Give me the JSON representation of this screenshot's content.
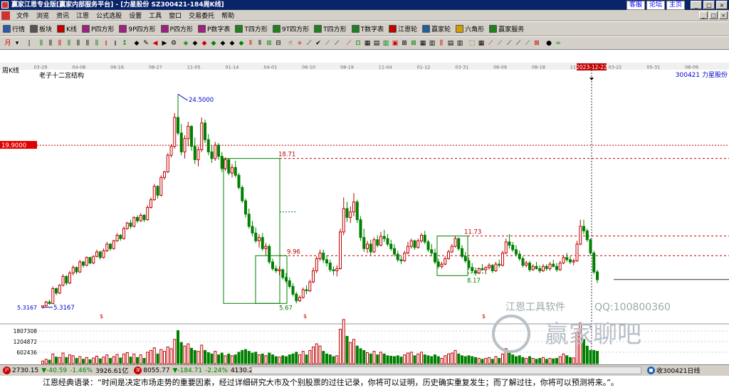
{
  "window": {
    "title": "赢家江恩专业版[赢家内部服务平台] - [力星股份  SZ300421-184周K线]",
    "links": [
      "客服",
      "论坛",
      "主页"
    ],
    "buttons": [
      "_",
      "□",
      "×"
    ]
  },
  "menu": [
    "文件",
    "浏览",
    "资讯",
    "江恩",
    "公式选股",
    "设置",
    "工具",
    "窗口",
    "交易委托",
    "帮助"
  ],
  "toolbar1": [
    {
      "label": "行情",
      "icon": "table-icon",
      "color": "#2a5aa8"
    },
    {
      "label": "板块",
      "icon": "sector-icon",
      "color": "#555555"
    },
    {
      "label": "K线",
      "icon": "candle-icon",
      "color": "#c00000"
    },
    {
      "label": "P四方形",
      "icon": "p-square-icon",
      "color": "#a02080"
    },
    {
      "label": "9P四方形",
      "icon": "9p-square-icon",
      "color": "#a02080"
    },
    {
      "label": "P四方形",
      "icon": "p-square-icon",
      "color": "#a02080"
    },
    {
      "label": "P数字表",
      "icon": "p-table-icon",
      "color": "#a02080"
    },
    {
      "label": "T四方形",
      "icon": "t-square-icon",
      "color": "#208020"
    },
    {
      "label": "9T四方形",
      "icon": "9t-square-icon",
      "color": "#208020"
    },
    {
      "label": "T四方形",
      "icon": "t-square-icon",
      "color": "#208020"
    },
    {
      "label": "T数字表",
      "icon": "t-table-icon",
      "color": "#208020"
    },
    {
      "label": "江恩轮",
      "icon": "wheel-icon",
      "color": "#c00000"
    },
    {
      "label": "赢家轮",
      "icon": "wheel-icon",
      "color": "#2060a0"
    },
    {
      "label": "六角形",
      "icon": "hexagon-icon",
      "color": "#d0a000"
    },
    {
      "label": "赢家服务",
      "icon": "service-icon",
      "color": "#208020"
    }
  ],
  "chart_label": "周K线",
  "stock_label": "300421  力星股份",
  "structure_label": "老子十二宫结构",
  "crosshair_date": "2023-12-22",
  "left_price_tag": "19.9000",
  "date_axis": [
    "03-29",
    "04-08",
    "06-16",
    "08-27",
    "11-05",
    "01-14",
    "04-01",
    "06-10",
    "08-19",
    "11-04",
    "01-12",
    "03-31",
    "06-09",
    "08-18",
    "11-03",
    "03-22",
    "05-31",
    "08-09"
  ],
  "annotations": {
    "high": "24.5000",
    "low_left": "5.3167",
    "low_left_axis": "5.3167",
    "level_1871": "18.71",
    "level_996": "9.96",
    "level_1173": "11.73",
    "level_817": "8.17",
    "low_mid": "5.67",
    "dollar_1": "$",
    "dollar_2": "$",
    "dollar_3": "$"
  },
  "volume_axis": [
    "1807308",
    "1204872",
    "602436"
  ],
  "watermark": {
    "software": "江恩工具软件",
    "qq": "QQ:100800360",
    "brand": "赢家聊吧"
  },
  "status": {
    "sh_value": "2730.15",
    "sh_change": "▼-40.59",
    "sh_pct": "-1.46%",
    "sh_amount": "3926.61亿",
    "sz_value": "8055.77",
    "sz_change": "▼-184.71",
    "sz_pct": "-2.24%",
    "sz_amount": "4130.2",
    "right_label": "收300421日线"
  },
  "quote": "江恩经典语录：“时间是决定市场走势的重要因素，经过详细研究大市及个别股票的过往记录，你将可以证明，历史确实重复发生；而了解过往，你将可以预测将来。”。",
  "colors": {
    "up": "#c00000",
    "down": "#008000",
    "level_line": "#c00000",
    "box": "#008000",
    "title_bar": "#0a246a",
    "crosshair_tag": "#c00000"
  },
  "chart_data": {
    "type": "candlestick",
    "ylim": [
      4.6,
      26.5
    ],
    "candles": [
      [
        5.32,
        5.5,
        5.2,
        5.45
      ],
      [
        5.45,
        5.9,
        5.4,
        5.8
      ],
      [
        5.8,
        6.0,
        5.55,
        5.65
      ],
      [
        5.65,
        7.2,
        5.6,
        7.0
      ],
      [
        7.0,
        7.1,
        6.4,
        6.6
      ],
      [
        6.6,
        7.4,
        6.5,
        7.3
      ],
      [
        7.3,
        8.3,
        7.2,
        8.1
      ],
      [
        8.1,
        8.2,
        7.3,
        7.5
      ],
      [
        7.5,
        8.6,
        7.4,
        8.4
      ],
      [
        8.4,
        9.1,
        8.2,
        8.9
      ],
      [
        8.9,
        9.0,
        8.3,
        8.5
      ],
      [
        8.5,
        9.6,
        8.4,
        9.4
      ],
      [
        9.4,
        9.5,
        8.9,
        9.1
      ],
      [
        9.1,
        9.9,
        9.0,
        9.8
      ],
      [
        9.8,
        9.85,
        9.2,
        9.3
      ],
      [
        9.3,
        10.0,
        9.2,
        9.9
      ],
      [
        9.9,
        10.5,
        9.8,
        10.3
      ],
      [
        10.3,
        10.4,
        9.6,
        9.8
      ],
      [
        9.8,
        10.6,
        9.7,
        10.4
      ],
      [
        10.4,
        11.2,
        10.3,
        11.0
      ],
      [
        11.0,
        11.1,
        10.4,
        10.6
      ],
      [
        10.6,
        11.4,
        10.5,
        11.3
      ],
      [
        11.3,
        12.0,
        11.2,
        11.8
      ],
      [
        11.8,
        11.9,
        11.3,
        11.5
      ],
      [
        11.5,
        12.6,
        11.4,
        12.4
      ],
      [
        12.4,
        13.0,
        12.3,
        12.9
      ],
      [
        12.9,
        13.2,
        12.4,
        12.6
      ],
      [
        12.6,
        13.5,
        12.5,
        13.4
      ],
      [
        13.4,
        13.6,
        12.9,
        13.1
      ],
      [
        13.1,
        13.8,
        13.0,
        13.6
      ],
      [
        13.6,
        13.7,
        13.0,
        13.2
      ],
      [
        13.2,
        14.5,
        13.1,
        14.3
      ],
      [
        14.3,
        15.2,
        14.2,
        15.0
      ],
      [
        15.0,
        16.4,
        14.9,
        16.2
      ],
      [
        16.2,
        16.3,
        15.1,
        15.4
      ],
      [
        15.4,
        17.2,
        15.3,
        17.0
      ],
      [
        17.0,
        17.6,
        16.8,
        17.5
      ],
      [
        17.5,
        19.2,
        17.4,
        19.0
      ],
      [
        19.0,
        20.0,
        18.8,
        19.8
      ],
      [
        19.8,
        22.8,
        19.6,
        22.4
      ],
      [
        22.4,
        24.5,
        20.8,
        21.0
      ],
      [
        21.0,
        21.8,
        19.0,
        19.3
      ],
      [
        19.3,
        20.8,
        18.7,
        20.5
      ],
      [
        20.5,
        22.0,
        19.8,
        21.6
      ],
      [
        21.6,
        21.7,
        19.4,
        19.8
      ],
      [
        19.8,
        20.6,
        18.2,
        18.6
      ],
      [
        18.6,
        19.8,
        18.0,
        19.5
      ],
      [
        19.5,
        22.4,
        19.3,
        21.9
      ],
      [
        21.9,
        22.2,
        20.1,
        20.4
      ],
      [
        20.4,
        20.9,
        19.0,
        19.3
      ],
      [
        19.3,
        19.9,
        18.3,
        18.7
      ],
      [
        18.7,
        20.2,
        18.5,
        19.9
      ],
      [
        19.9,
        20.1,
        18.6,
        18.9
      ],
      [
        18.9,
        19.3,
        17.5,
        17.8
      ],
      [
        17.8,
        18.8,
        17.6,
        18.6
      ],
      [
        18.6,
        18.7,
        17.2,
        17.4
      ],
      [
        17.4,
        18.2,
        17.0,
        17.9
      ],
      [
        17.9,
        18.5,
        17.0,
        17.2
      ],
      [
        17.2,
        17.4,
        15.9,
        16.1
      ],
      [
        16.1,
        16.3,
        14.7,
        14.9
      ],
      [
        14.9,
        15.1,
        13.4,
        13.7
      ],
      [
        13.7,
        14.2,
        12.4,
        12.6
      ],
      [
        12.6,
        13.1,
        11.7,
        12.0
      ],
      [
        12.0,
        12.5,
        11.1,
        11.3
      ],
      [
        11.3,
        11.9,
        10.7,
        11.6
      ],
      [
        11.6,
        12.0,
        10.4,
        10.6
      ],
      [
        10.6,
        11.1,
        10.0,
        10.8
      ],
      [
        10.8,
        11.0,
        9.2,
        9.4
      ],
      [
        9.4,
        9.7,
        8.6,
        8.8
      ],
      [
        8.8,
        9.1,
        8.4,
        8.6
      ],
      [
        8.6,
        9.0,
        8.2,
        8.7
      ],
      [
        8.7,
        8.8,
        7.8,
        8.0
      ],
      [
        8.0,
        8.4,
        7.5,
        7.7
      ],
      [
        7.7,
        8.0,
        7.0,
        7.2
      ],
      [
        7.2,
        7.5,
        6.3,
        6.5
      ],
      [
        6.5,
        6.7,
        5.67,
        5.9
      ],
      [
        5.9,
        6.4,
        5.8,
        6.2
      ],
      [
        6.2,
        7.1,
        6.1,
        6.9
      ],
      [
        6.9,
        7.3,
        6.5,
        6.8
      ],
      [
        6.8,
        7.8,
        6.7,
        7.6
      ],
      [
        7.6,
        8.9,
        7.5,
        8.6
      ],
      [
        8.6,
        9.9,
        8.4,
        9.7
      ],
      [
        9.7,
        10.5,
        9.5,
        10.2
      ],
      [
        10.2,
        10.5,
        9.3,
        9.6
      ],
      [
        9.6,
        10.0,
        9.0,
        9.3
      ],
      [
        9.3,
        9.6,
        8.5,
        8.7
      ],
      [
        8.7,
        9.0,
        8.2,
        8.6
      ],
      [
        8.6,
        9.1,
        8.1,
        8.8
      ],
      [
        8.8,
        12.4,
        8.7,
        12.1
      ],
      [
        12.1,
        15.2,
        11.8,
        14.2
      ],
      [
        14.2,
        14.8,
        13.0,
        13.4
      ],
      [
        13.4,
        14.4,
        12.9,
        13.9
      ],
      [
        13.9,
        15.6,
        13.5,
        14.8
      ],
      [
        14.8,
        15.0,
        12.9,
        13.2
      ],
      [
        13.2,
        13.5,
        11.3,
        11.6
      ],
      [
        11.6,
        12.4,
        10.3,
        10.6
      ],
      [
        10.6,
        11.3,
        10.2,
        11.0
      ],
      [
        11.0,
        11.4,
        10.0,
        10.3
      ],
      [
        10.3,
        11.6,
        10.2,
        11.4
      ],
      [
        11.4,
        11.8,
        10.7,
        10.9
      ],
      [
        10.9,
        12.1,
        10.8,
        11.7
      ],
      [
        11.7,
        12.3,
        11.2,
        11.5
      ],
      [
        11.5,
        11.9,
        10.8,
        11.0
      ],
      [
        11.0,
        11.4,
        10.4,
        10.6
      ],
      [
        10.6,
        11.0,
        9.9,
        10.1
      ],
      [
        10.1,
        10.4,
        9.4,
        9.6
      ],
      [
        9.6,
        9.9,
        9.2,
        9.5
      ],
      [
        9.5,
        10.4,
        9.4,
        10.2
      ],
      [
        10.2,
        11.2,
        10.1,
        10.8
      ],
      [
        10.8,
        11.5,
        10.6,
        11.3
      ],
      [
        11.3,
        11.4,
        10.5,
        10.7
      ],
      [
        10.7,
        11.5,
        10.6,
        11.3
      ],
      [
        11.3,
        12.0,
        11.1,
        11.8
      ],
      [
        11.8,
        12.2,
        11.0,
        11.2
      ],
      [
        11.2,
        11.4,
        10.3,
        10.5
      ],
      [
        10.5,
        11.0,
        9.9,
        10.2
      ],
      [
        10.2,
        10.6,
        9.2,
        9.4
      ],
      [
        9.4,
        9.7,
        8.8,
        9.0
      ],
      [
        9.0,
        9.4,
        8.8,
        9.2
      ],
      [
        9.2,
        9.9,
        9.1,
        9.7
      ],
      [
        9.7,
        10.5,
        9.6,
        10.3
      ],
      [
        10.3,
        11.0,
        10.2,
        10.8
      ],
      [
        10.8,
        11.73,
        10.7,
        11.5
      ],
      [
        11.5,
        11.6,
        10.4,
        10.6
      ],
      [
        10.6,
        10.9,
        9.7,
        9.9
      ],
      [
        9.9,
        10.3,
        9.3,
        9.5
      ],
      [
        9.5,
        9.8,
        8.7,
        8.9
      ],
      [
        8.9,
        9.3,
        8.4,
        8.6
      ],
      [
        8.6,
        8.9,
        8.17,
        8.4
      ],
      [
        8.4,
        8.9,
        8.3,
        8.8
      ],
      [
        8.8,
        9.2,
        8.6,
        8.7
      ],
      [
        8.7,
        9.0,
        8.3,
        8.9
      ],
      [
        8.9,
        9.3,
        8.7,
        9.1
      ],
      [
        9.1,
        9.2,
        8.4,
        8.6
      ],
      [
        8.6,
        9.4,
        8.5,
        9.2
      ],
      [
        9.2,
        9.6,
        8.9,
        9.1
      ],
      [
        9.1,
        10.4,
        9.0,
        10.2
      ],
      [
        10.2,
        11.5,
        10.1,
        11.2
      ],
      [
        11.2,
        11.9,
        10.6,
        10.9
      ],
      [
        10.9,
        11.2,
        10.3,
        10.5
      ],
      [
        10.5,
        10.9,
        9.9,
        10.1
      ],
      [
        10.1,
        10.4,
        9.5,
        9.7
      ],
      [
        9.7,
        9.9,
        8.9,
        9.1
      ],
      [
        9.1,
        9.5,
        8.9,
        9.3
      ],
      [
        9.3,
        9.5,
        8.5,
        8.7
      ],
      [
        8.7,
        9.2,
        8.6,
        9.0
      ],
      [
        9.0,
        9.4,
        8.7,
        8.8
      ],
      [
        8.8,
        9.1,
        8.4,
        8.6
      ],
      [
        8.6,
        9.2,
        8.5,
        9.0
      ],
      [
        9.0,
        9.2,
        8.6,
        8.8
      ],
      [
        8.8,
        9.4,
        8.6,
        9.2
      ],
      [
        9.2,
        9.6,
        8.9,
        9.0
      ],
      [
        9.0,
        9.3,
        8.5,
        8.7
      ],
      [
        8.7,
        9.5,
        8.6,
        9.3
      ],
      [
        9.3,
        10.0,
        9.2,
        9.8
      ],
      [
        9.8,
        10.2,
        9.4,
        9.6
      ],
      [
        9.6,
        9.9,
        9.2,
        9.4
      ],
      [
        9.4,
        9.7,
        9.1,
        9.5
      ],
      [
        9.5,
        11.3,
        9.4,
        11.0
      ],
      [
        11.0,
        13.2,
        10.9,
        12.6
      ],
      [
        12.6,
        13.2,
        11.9,
        12.2
      ],
      [
        12.2,
        12.4,
        11.2,
        11.4
      ],
      [
        11.4,
        11.5,
        10.0,
        10.2
      ],
      [
        10.2,
        10.4,
        8.3,
        8.5
      ],
      [
        8.5,
        8.7,
        7.5,
        7.8
      ]
    ],
    "volumes": [
      0.06,
      0.1,
      0.08,
      0.22,
      0.15,
      0.14,
      0.24,
      0.14,
      0.2,
      0.18,
      0.12,
      0.16,
      0.1,
      0.14,
      0.09,
      0.13,
      0.17,
      0.11,
      0.15,
      0.2,
      0.12,
      0.16,
      0.21,
      0.13,
      0.22,
      0.25,
      0.15,
      0.22,
      0.14,
      0.2,
      0.12,
      0.26,
      0.3,
      0.36,
      0.22,
      0.32,
      0.28,
      0.38,
      0.34,
      0.55,
      0.75,
      0.48,
      0.4,
      0.45,
      0.35,
      0.3,
      0.28,
      0.42,
      0.3,
      0.25,
      0.22,
      0.28,
      0.2,
      0.24,
      0.18,
      0.22,
      0.18,
      0.2,
      0.26,
      0.3,
      0.32,
      0.28,
      0.24,
      0.26,
      0.2,
      0.22,
      0.18,
      0.24,
      0.2,
      0.16,
      0.15,
      0.18,
      0.16,
      0.2,
      0.22,
      0.26,
      0.2,
      0.28,
      0.2,
      0.3,
      0.38,
      0.45,
      0.4,
      0.28,
      0.22,
      0.2,
      0.16,
      0.18,
      0.78,
      1.0,
      0.62,
      0.48,
      0.55,
      0.4,
      0.34,
      0.3,
      0.25,
      0.22,
      0.28,
      0.2,
      0.26,
      0.22,
      0.18,
      0.17,
      0.16,
      0.18,
      0.15,
      0.2,
      0.24,
      0.26,
      0.18,
      0.22,
      0.26,
      0.2,
      0.18,
      0.16,
      0.2,
      0.16,
      0.12,
      0.18,
      0.22,
      0.24,
      0.3,
      0.22,
      0.18,
      0.16,
      0.18,
      0.16,
      0.14,
      0.12,
      0.1,
      0.12,
      0.14,
      0.1,
      0.16,
      0.12,
      0.22,
      0.34,
      0.26,
      0.2,
      0.16,
      0.18,
      0.14,
      0.12,
      0.16,
      0.12,
      0.1,
      0.12,
      0.14,
      0.1,
      0.12,
      0.11,
      0.12,
      0.16,
      0.22,
      0.18,
      0.14,
      0.13,
      0.72,
      0.92,
      0.55,
      0.4,
      0.3,
      0.3,
      0.28
    ]
  }
}
